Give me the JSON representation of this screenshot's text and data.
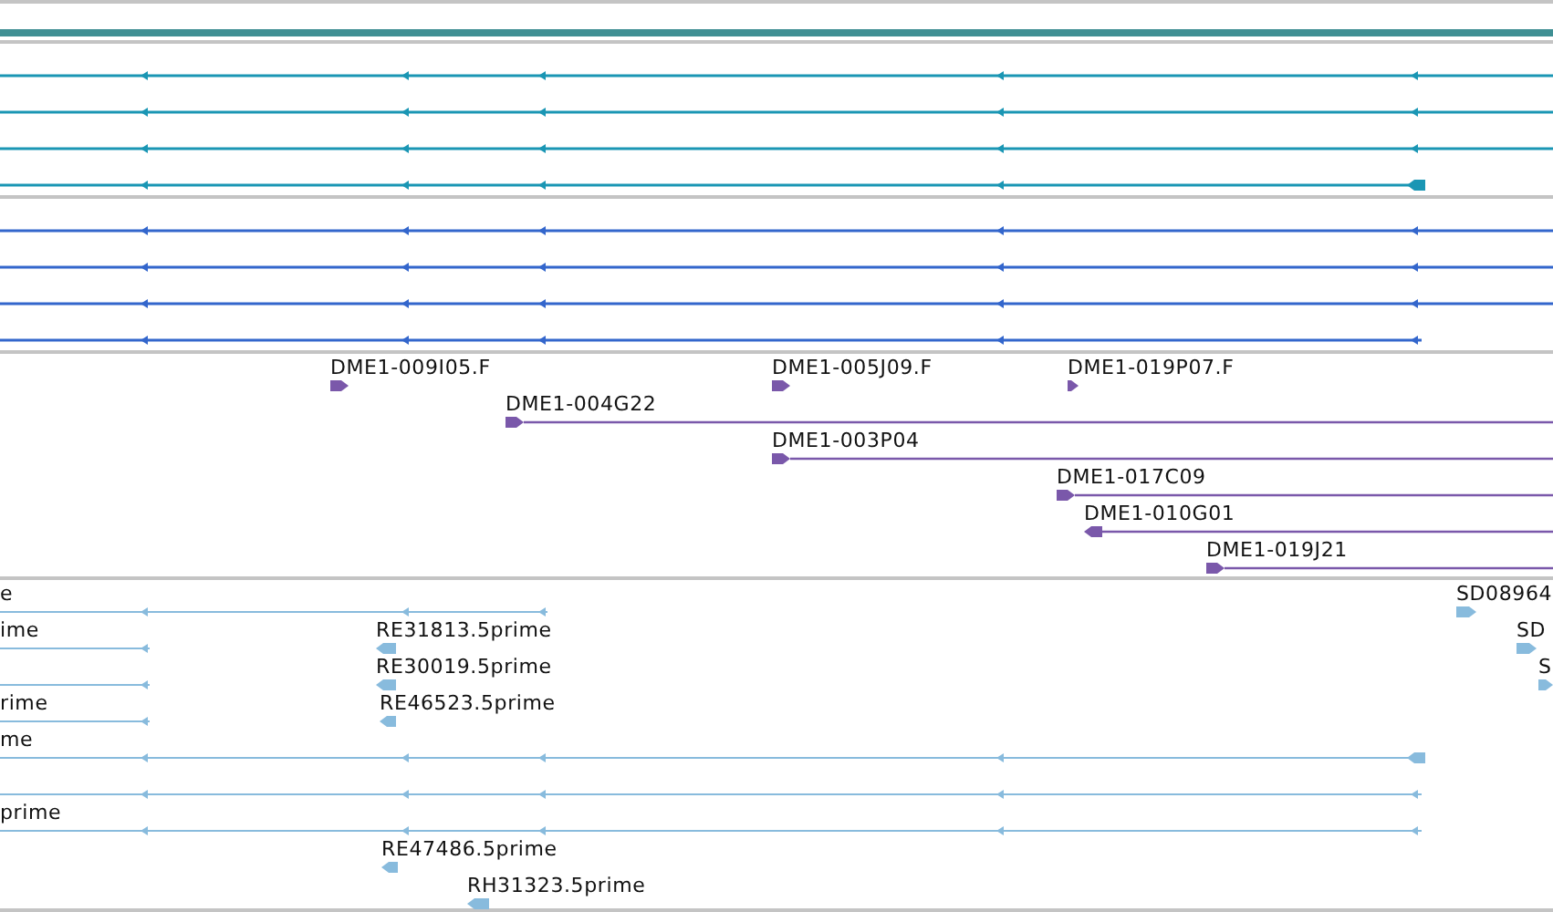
{
  "tracks": [
    {
      "kind": "transcripts",
      "color": "#1a96b4",
      "rows": [
        {
          "features": [
            {
              "kind": "spliced",
              "reverse": true
            }
          ]
        },
        {
          "features": [
            {
              "kind": "spliced",
              "reverse": true
            }
          ]
        },
        {
          "features": [
            {
              "kind": "spliced",
              "reverse": true
            }
          ]
        },
        {
          "features": [
            {
              "kind": "spliced",
              "reverse": true
            }
          ]
        }
      ]
    },
    {
      "kind": "transcripts",
      "color": "#3366cc",
      "rows": [
        {
          "features": [
            {
              "kind": "spliced",
              "reverse": true
            }
          ]
        },
        {
          "features": [
            {
              "kind": "spliced",
              "reverse": true
            }
          ]
        },
        {
          "features": [
            {
              "kind": "spliced",
              "reverse": true
            }
          ]
        },
        {
          "features": [
            {
              "kind": "spliced",
              "reverse": true
            }
          ]
        }
      ]
    },
    {
      "kind": "reads",
      "color": "#7a58aa",
      "rows": [
        {
          "features": [
            {
              "kind": "read",
              "reverse": false,
              "label": "DME1-009I05.F"
            },
            {
              "kind": "read",
              "reverse": false,
              "label": "DME1-005J09.F"
            },
            {
              "kind": "read",
              "reverse": false,
              "label": "DME1-019P07.F"
            }
          ]
        },
        {
          "features": [
            {
              "kind": "read",
              "reverse": false,
              "label": "DME1-004G22"
            }
          ]
        },
        {
          "features": [
            {
              "kind": "read",
              "reverse": false,
              "label": "DME1-003P04"
            }
          ]
        },
        {
          "features": [
            {
              "kind": "read",
              "reverse": false,
              "label": "DME1-017C09"
            }
          ]
        },
        {
          "features": [
            {
              "kind": "read",
              "reverse": true,
              "label": "DME1-010G01"
            }
          ]
        },
        {
          "features": [
            {
              "kind": "read",
              "reverse": false,
              "label": "DME1-019J21"
            }
          ]
        }
      ]
    },
    {
      "kind": "reads",
      "color": "#88bbdd",
      "rows": [
        {
          "features": [
            {
              "kind": "spliced",
              "reverse": true,
              "label": "e"
            },
            {
              "kind": "read",
              "reverse": false,
              "label": "SD08964"
            }
          ]
        },
        {
          "features": [
            {
              "kind": "spliced",
              "reverse": true,
              "label": "ime"
            },
            {
              "kind": "read",
              "reverse": true,
              "label": "RE31813.5prime"
            },
            {
              "kind": "read",
              "reverse": false,
              "label": "SD"
            }
          ]
        },
        {
          "features": [
            {
              "kind": "spliced",
              "reverse": true
            },
            {
              "kind": "read",
              "reverse": true,
              "label": "RE30019.5prime"
            },
            {
              "kind": "read",
              "reverse": false,
              "label": "S"
            }
          ]
        },
        {
          "features": [
            {
              "kind": "spliced",
              "reverse": true,
              "label": "rime"
            },
            {
              "kind": "read",
              "reverse": true,
              "label": "RE46523.5prime"
            }
          ]
        },
        {
          "features": [
            {
              "kind": "spliced",
              "reverse": true,
              "label": "me"
            }
          ]
        },
        {
          "features": [
            {
              "kind": "spliced",
              "reverse": true
            }
          ]
        },
        {
          "features": [
            {
              "kind": "spliced",
              "reverse": true,
              "label": "prime"
            }
          ]
        },
        {
          "features": [
            {
              "kind": "read",
              "reverse": true,
              "label": "RE47486.5prime"
            }
          ]
        },
        {
          "features": [
            {
              "kind": "read",
              "reverse": true,
              "label": "RH31323.5prime"
            }
          ]
        }
      ]
    }
  ]
}
